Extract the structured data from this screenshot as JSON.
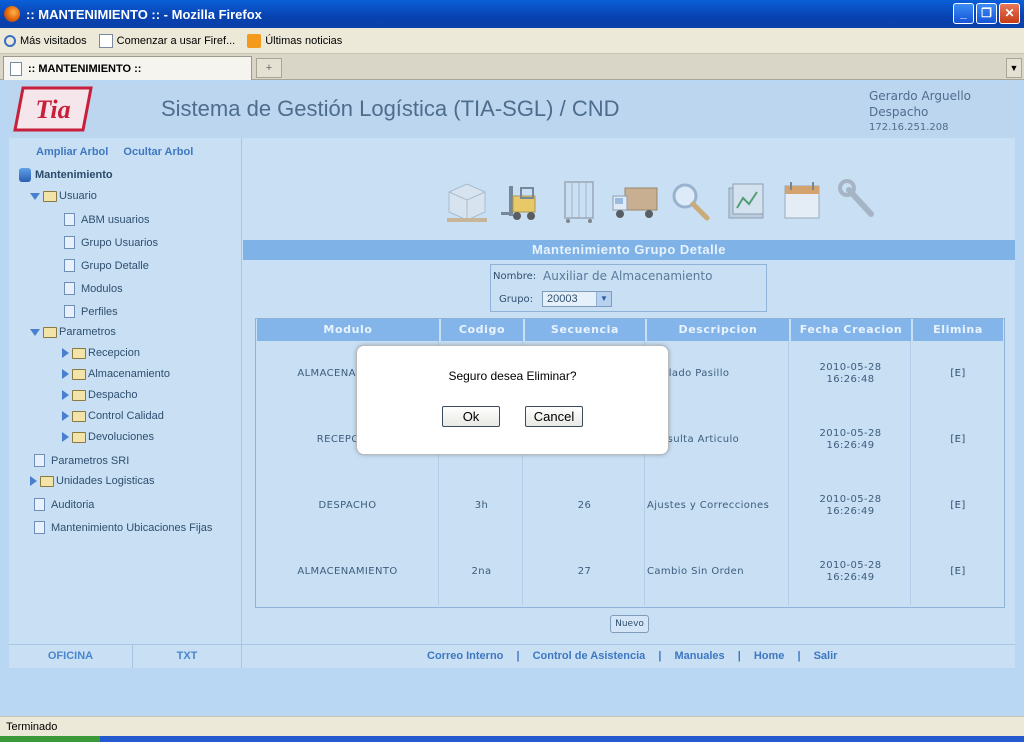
{
  "window": {
    "title": ":: MANTENIMIENTO :: - Mozilla Firefox"
  },
  "bookmarks": [
    {
      "label": "Más visitados",
      "icon": "search-icon"
    },
    {
      "label": "Comenzar a usar Firef...",
      "icon": "page-icon"
    },
    {
      "label": "Últimas noticias",
      "icon": "rss-icon"
    }
  ],
  "tab": {
    "label": ":: MANTENIMIENTO ::",
    "new_tab": "+"
  },
  "header": {
    "title": "Sistema de Gestión Logística (TIA-SGL) / CND",
    "user": "Gerardo Arguello",
    "role": "Despacho",
    "ip": "172.16.251.208",
    "logo_text": "Tia"
  },
  "sidebar": {
    "expand_link": "Ampliar Arbol",
    "hide_link": "Ocultar Arbol",
    "root": "Mantenimiento",
    "items": [
      {
        "label": "Usuario"
      },
      {
        "label": "ABM usuarios"
      },
      {
        "label": "Grupo Usuarios"
      },
      {
        "label": "Grupo Detalle"
      },
      {
        "label": "Modulos"
      },
      {
        "label": "Perfiles"
      },
      {
        "label": "Parametros"
      },
      {
        "label": "Recepcion"
      },
      {
        "label": "Almacenamiento"
      },
      {
        "label": "Despacho"
      },
      {
        "label": "Control Calidad"
      },
      {
        "label": "Devoluciones"
      },
      {
        "label": "Parametros SRI"
      },
      {
        "label": "Unidades Logisticas"
      },
      {
        "label": "Auditoria"
      },
      {
        "label": "Mantenimiento Ubicaciones Fijas"
      }
    ]
  },
  "main": {
    "section_title": "Mantenimiento Grupo Detalle",
    "filter": {
      "nombre_label": "Nombre:",
      "nombre_value": "Auxiliar de Almacenamiento",
      "grupo_label": "Grupo:",
      "grupo_value": "20003"
    },
    "columns": [
      "Modulo",
      "Codigo",
      "Secuencia",
      "Descripcion",
      "Fecha Creacion",
      "Elimina"
    ],
    "rows": [
      {
        "modulo": "ALMACENAMIENTO",
        "codigo": "",
        "secuencia": "",
        "descripcion": "Traslado Pasillo",
        "fecha": "2010-05-28",
        "hora": "16:26:48",
        "elimina": "[E]"
      },
      {
        "modulo": "RECEPCION",
        "codigo": "",
        "secuencia": "",
        "descripcion": "Consulta Articulo",
        "fecha": "2010-05-28",
        "hora": "16:26:49",
        "elimina": "[E]"
      },
      {
        "modulo": "DESPACHO",
        "codigo": "3h",
        "secuencia": "26",
        "descripcion": "Ajustes y Correcciones",
        "fecha": "2010-05-28",
        "hora": "16:26:49",
        "elimina": "[E]"
      },
      {
        "modulo": "ALMACENAMIENTO",
        "codigo": "2na",
        "secuencia": "27",
        "descripcion": "Cambio Sin Orden",
        "fecha": "2010-05-28",
        "hora": "16:26:49",
        "elimina": "[E]"
      }
    ],
    "nuevo_button": "Nuevo"
  },
  "footer": {
    "oficina": "OFICINA",
    "txt": "TXT",
    "links": [
      "Correo Interno",
      "Control de Asistencia",
      "Manuales",
      "Home",
      "Salir"
    ],
    "separator": "|"
  },
  "dialog": {
    "message": "Seguro desea Eliminar?",
    "ok": "Ok",
    "cancel": "Cancel"
  },
  "statusbar": {
    "text": "Terminado"
  }
}
